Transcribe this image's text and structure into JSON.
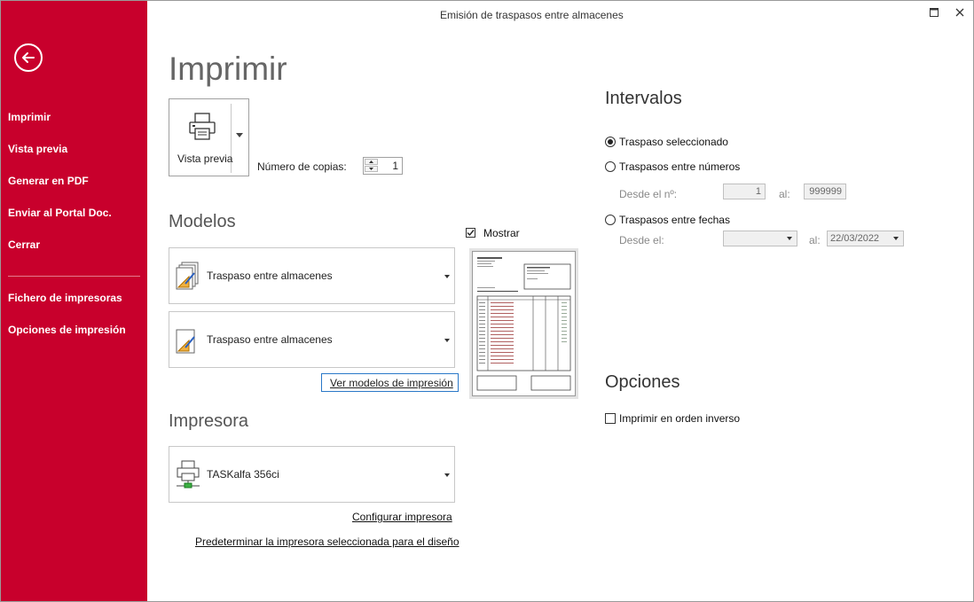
{
  "window": {
    "title": "Emisión de traspasos entre almacenes"
  },
  "sidebar": {
    "items": [
      {
        "label": "Imprimir"
      },
      {
        "label": "Vista previa"
      },
      {
        "label": "Generar en PDF"
      },
      {
        "label": "Enviar al Portal Doc."
      },
      {
        "label": "Cerrar"
      },
      {
        "label": "Fichero de impresoras"
      },
      {
        "label": "Opciones de impresión"
      }
    ]
  },
  "print": {
    "title": "Imprimir",
    "preview_label": "Vista previa",
    "copies_label": "Número de copias:",
    "copies_value": "1"
  },
  "modelos": {
    "heading": "Modelos",
    "items": [
      {
        "label": "Traspaso entre almacenes"
      },
      {
        "label": "Traspaso entre almacenes"
      }
    ],
    "link": "Ver modelos de impresión",
    "show_label": "Mostrar",
    "show_checked": true
  },
  "impresora": {
    "heading": "Impresora",
    "selected": "TASKalfa 356ci",
    "configure_link": "Configurar impresora",
    "default_link": "Predeterminar la impresora seleccionada para el diseño"
  },
  "intervalos": {
    "heading": "Intervalos",
    "options": [
      {
        "label": "Traspaso seleccionado",
        "selected": true
      },
      {
        "label": "Traspasos entre números",
        "selected": false
      },
      {
        "label": "Traspasos entre fechas",
        "selected": false
      }
    ],
    "desde_no_label": "Desde el nº:",
    "desde_no_value": "1",
    "al_label": "al:",
    "al_no_value": "999999",
    "desde_fecha_label": "Desde el:",
    "desde_fecha_value": "",
    "al_fecha_value": "22/03/2022"
  },
  "opciones": {
    "heading": "Opciones",
    "reverse_label": "Imprimir en orden inverso",
    "reverse_checked": false
  },
  "colors": {
    "sidebar": "#c8002c",
    "link_focus": "#2a78c8"
  }
}
